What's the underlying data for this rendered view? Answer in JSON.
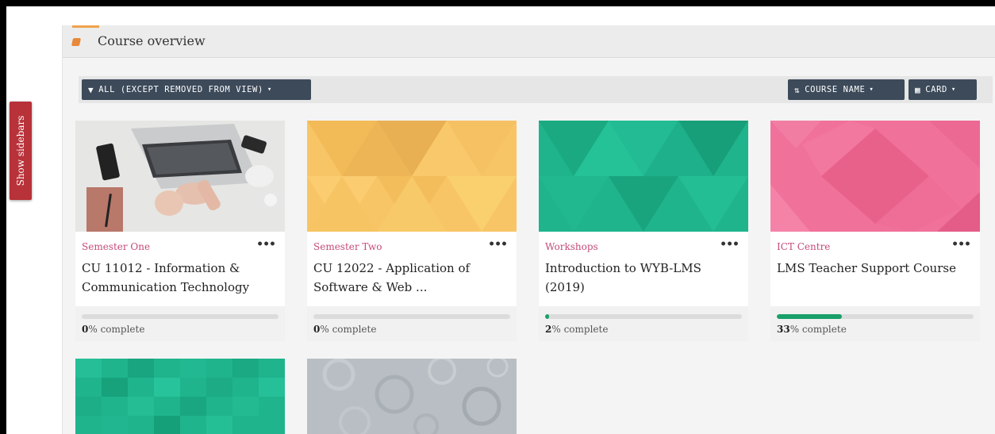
{
  "sidebar": {
    "show_label": "Show sidebars"
  },
  "block": {
    "title": "Course overview"
  },
  "toolbar": {
    "filter_label": "ALL (EXCEPT REMOVED FROM VIEW)",
    "sort_label": "COURSE NAME",
    "view_label": "CARD"
  },
  "courses": [
    {
      "category": "Semester One",
      "name": "CU 11012 - Information & Communication Technology",
      "progress": 0,
      "progress_value": "0",
      "progress_suffix": "% complete"
    },
    {
      "category": "Semester Two",
      "name": "CU 12022 - Application of Software & Web ...",
      "progress": 0,
      "progress_value": "0",
      "progress_suffix": "% complete"
    },
    {
      "category": "Workshops",
      "name": "Introduction to WYB-LMS (2019)",
      "progress": 2,
      "progress_value": "2",
      "progress_suffix": "% complete"
    },
    {
      "category": "ICT Centre",
      "name": "LMS Teacher Support Course",
      "progress": 33,
      "progress_value": "33",
      "progress_suffix": "% complete"
    }
  ],
  "colors": {
    "sidebar_bg": "#b8323a",
    "toolbar_btn": "#3c4a5a",
    "category_text": "#c44b7a",
    "progress_fill": "#1aa06a",
    "card2_bg": "#f8c566",
    "card3_bg": "#1fb48c",
    "card4_bg": "#f0719a",
    "card5_bg": "#1fb48c",
    "card6_bg": "#b8bec3"
  },
  "icons": {
    "filter": "filter-icon",
    "sort": "sort-icon",
    "view": "grid-icon",
    "menu": "more-icon",
    "block": "course-overview-icon"
  }
}
